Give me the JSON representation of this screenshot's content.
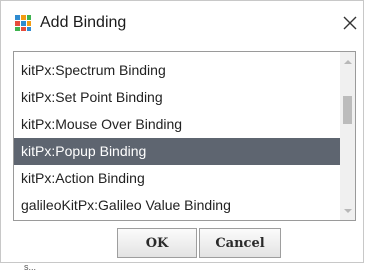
{
  "window": {
    "title": "Add Binding",
    "icon": "binding-app-icon",
    "close_icon": "close-icon"
  },
  "list": {
    "items": [
      {
        "label": "kitPx:Spectrum Binding",
        "selected": false
      },
      {
        "label": "kitPx:Set Point Binding",
        "selected": false
      },
      {
        "label": "kitPx:Mouse Over Binding",
        "selected": false
      },
      {
        "label": "kitPx:Popup Binding",
        "selected": true
      },
      {
        "label": "kitPx:Action Binding",
        "selected": false
      },
      {
        "label": "galileoKitPx:Galileo Value Binding",
        "selected": false
      }
    ],
    "selected_color": "#5e6570"
  },
  "buttons": {
    "ok_label": "OK",
    "cancel_label": "Cancel"
  },
  "background": {
    "partial_text": "s..."
  }
}
